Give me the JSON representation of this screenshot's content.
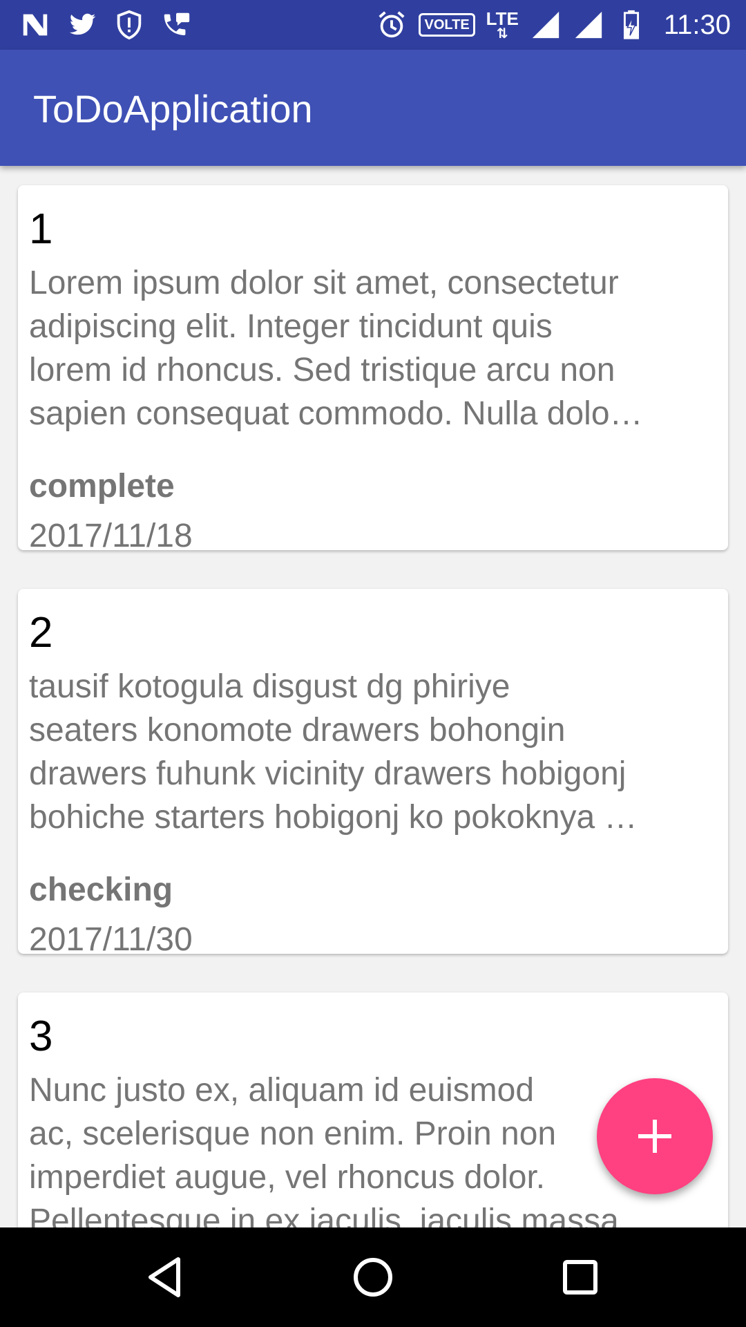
{
  "status_bar": {
    "left_icons": [
      "n-icon",
      "twitter-icon",
      "shield-alert-icon",
      "phone-chat-icon"
    ],
    "volte_label": "VOLTE",
    "network_label": "LTE",
    "time": "11:30"
  },
  "app_bar": {
    "title": "ToDoApplication"
  },
  "todos": [
    {
      "number": "1",
      "description_lines": [
        "Lorem ipsum dolor sit amet, consectetur",
        "adipiscing elit. Integer tincidunt quis",
        "lorem id rhoncus. Sed tristique arcu non",
        "sapien consequat commodo. Nulla dolo…"
      ],
      "status": "complete",
      "date": "2017/11/18"
    },
    {
      "number": "2",
      "description_lines": [
        "tausif kotogula disgust dg phiriye",
        "seaters konomote drawers bohongin",
        "drawers fuhunk vicinity drawers hobigonj",
        "bohiche starters hobigonj ko pokoknya …"
      ],
      "status": "checking",
      "date": "2017/11/30"
    },
    {
      "number": "3",
      "description_lines": [
        "Nunc justo ex, aliquam id euismod",
        "ac, scelerisque non enim. Proin non",
        "imperdiet augue, vel rhoncus dolor.",
        "Pellentesque in ex iaculis, iaculis massa"
      ]
    }
  ],
  "fab": {
    "icon": "plus-icon",
    "color": "#ff4081"
  },
  "colors": {
    "primary": "#3f51b5",
    "primary_dark": "#303f9f",
    "accent": "#ff4081",
    "secondary_text": "#757575"
  },
  "nav_bar": {
    "icons": [
      "back-icon",
      "home-icon",
      "recents-icon"
    ]
  }
}
